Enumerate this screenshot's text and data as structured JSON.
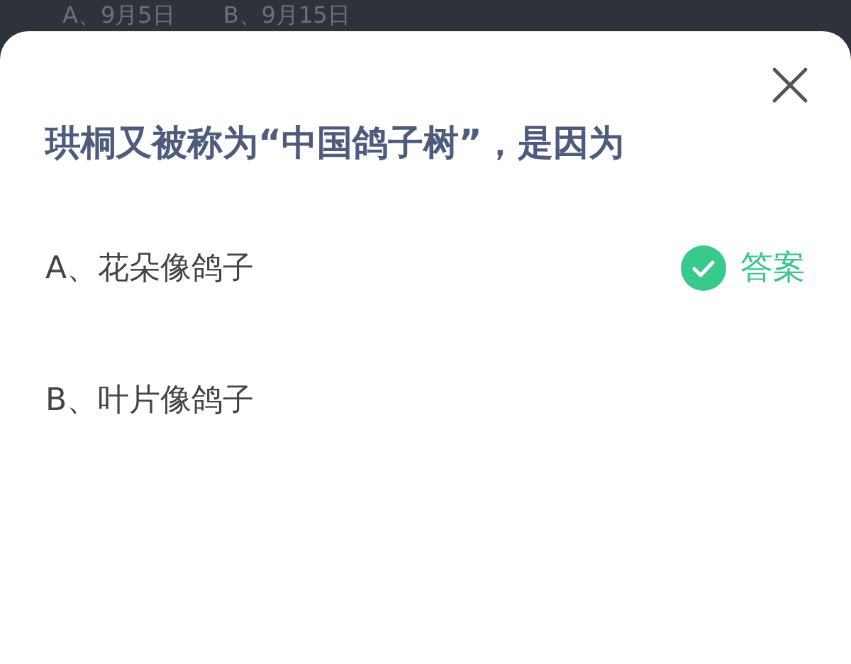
{
  "background_options": [
    {
      "label": "A、9月5日"
    },
    {
      "label": "B、9月15日"
    }
  ],
  "question": {
    "title": "珙桐又被称为“中国鸽子树”，是因为"
  },
  "options": [
    {
      "label": "A、花朵像鸽子",
      "answer": true,
      "answer_label": "答案"
    },
    {
      "label": "B、叶片像鸽子",
      "answer": false
    }
  ]
}
